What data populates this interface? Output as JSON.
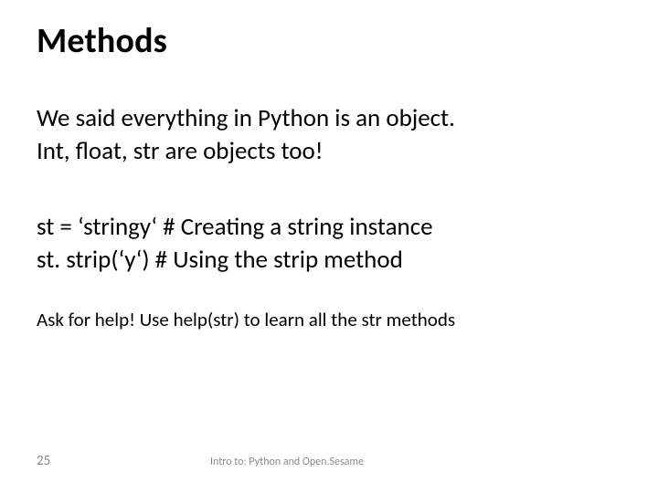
{
  "title": "Methods",
  "paragraphs": {
    "p1_line1": "We said everything in Python is an object.",
    "p1_line2": "Int, float, str are objects too!",
    "p2_line1": "st = ‘stringy‘ # Creating a string instance",
    "p2_line2": "st. strip(‘y‘) # Using the strip method",
    "p3": "Ask for help! Use help(str) to learn all the str methods"
  },
  "footer": {
    "page": "25",
    "text": "Intro to: Python and Open.Sesame"
  }
}
